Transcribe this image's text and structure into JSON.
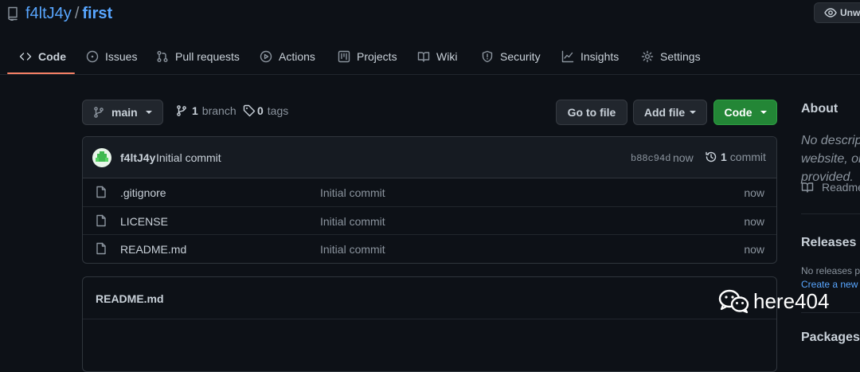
{
  "header": {
    "owner": "f4ltJ4y",
    "separator": "/",
    "repo": "first",
    "watch_label": "Unwatch"
  },
  "tabs": [
    {
      "label": "Code",
      "icon": "code-icon",
      "active": true
    },
    {
      "label": "Issues",
      "icon": "issue-icon"
    },
    {
      "label": "Pull requests",
      "icon": "pull-request-icon"
    },
    {
      "label": "Actions",
      "icon": "play-icon"
    },
    {
      "label": "Projects",
      "icon": "project-icon"
    },
    {
      "label": "Wiki",
      "icon": "book-icon"
    },
    {
      "label": "Security",
      "icon": "shield-icon"
    },
    {
      "label": "Insights",
      "icon": "graph-icon"
    },
    {
      "label": "Settings",
      "icon": "gear-icon"
    }
  ],
  "toolbar": {
    "branch": "main",
    "branch_count": "1",
    "branch_word": "branch",
    "tag_count": "0",
    "tag_word": "tags",
    "go_to_file": "Go to file",
    "add_file": "Add file",
    "code": "Code"
  },
  "commit": {
    "author": "f4ltJ4y",
    "message": "Initial commit",
    "sha": "b88c94d",
    "age": "now",
    "count": "1",
    "count_word": "commit"
  },
  "files": [
    {
      "name": ".gitignore",
      "message": "Initial commit",
      "age": "now"
    },
    {
      "name": "LICENSE",
      "message": "Initial commit",
      "age": "now"
    },
    {
      "name": "README.md",
      "message": "Initial commit",
      "age": "now"
    }
  ],
  "readme": {
    "title": "README.md"
  },
  "sidebar": {
    "about_title": "About",
    "about_desc": "No description, website, or topics provided.",
    "readme_link": "Readme",
    "releases_title": "Releases",
    "no_releases": "No releases published",
    "create_release": "Create a new release",
    "packages_title": "Packages"
  },
  "watermark": {
    "text": "here404"
  },
  "colors": {
    "background": "#0d1117",
    "accent_link": "#58a6ff",
    "code_button": "#238636",
    "tab_underline": "#f78166",
    "muted_text": "#8b949e"
  }
}
